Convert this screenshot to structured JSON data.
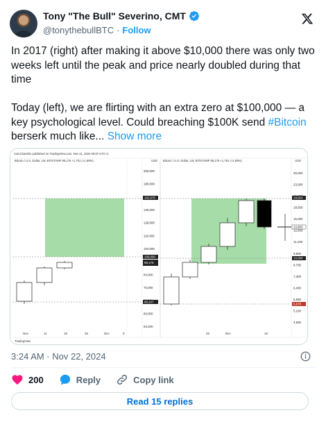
{
  "author": {
    "display_name": "Tony \"The Bull\" Severino, CMT",
    "handle": "@tonythebullBTC",
    "separator": "·",
    "follow_label": "Follow"
  },
  "tweet": {
    "para1": "In 2017 (right) after making it above $10,000 there was only two weeks left until the peak and price nearly doubled during that time",
    "para2_text": "Today (left), we are flirting with an extra zero at $100,000 — a key psychological level. Could breaching $100K send ",
    "hashtag": "#Bitcoin",
    "para2_tail": " berserk much like... ",
    "show_more": "Show more"
  },
  "chart_image": {
    "header": "CoinCharts/tv published on TradingView.com, Nov 21, 2024 00:07 UTC+1",
    "left_title": "Bitcoin / U.S. Dollar, 1W, BITSTAMP  98,176  +1,701 (+1.89%)",
    "right_title": "Bitcoin / U.S. Dollar, 1W, BITSTAMP  98,176  +1,761 (+1.89%)",
    "usd": "USD",
    "left_axis": [
      "200,000",
      "180,000",
      "160,000",
      "140,000",
      "128,000",
      "116,000",
      "104,000",
      "94,000",
      "84,000",
      "75,000",
      "68,000",
      "60,000",
      "54,200"
    ],
    "left_axis_tags": [
      "152,575",
      "100,000",
      "98,176",
      "68,107"
    ],
    "left_x": [
      "Nov",
      "11",
      "18",
      "25",
      "Dec",
      "9"
    ],
    "right_axis": [
      "30,000",
      "23,000",
      "21,000",
      "18,500",
      "15,000",
      "12,500",
      "11,100",
      "9,800",
      "8,700",
      "7,300",
      "6,400",
      "5,650",
      "5,100",
      "4,600"
    ],
    "right_axis_tags": [
      "19,664",
      "10,000",
      "5,678",
      "13,963"
    ],
    "right_x": [
      "26",
      "Dec",
      "18"
    ],
    "footer": "TradingView",
    "colors": {
      "highlight": "#a6dca8",
      "candle_up": "#ffffff",
      "candle_down": "#000000"
    }
  },
  "meta": {
    "timestamp": "3:24 AM · Nov 22, 2024"
  },
  "actions": {
    "likes": "200",
    "reply_label": "Reply",
    "copy_label": "Copy link",
    "read_replies": "Read 15 replies"
  }
}
